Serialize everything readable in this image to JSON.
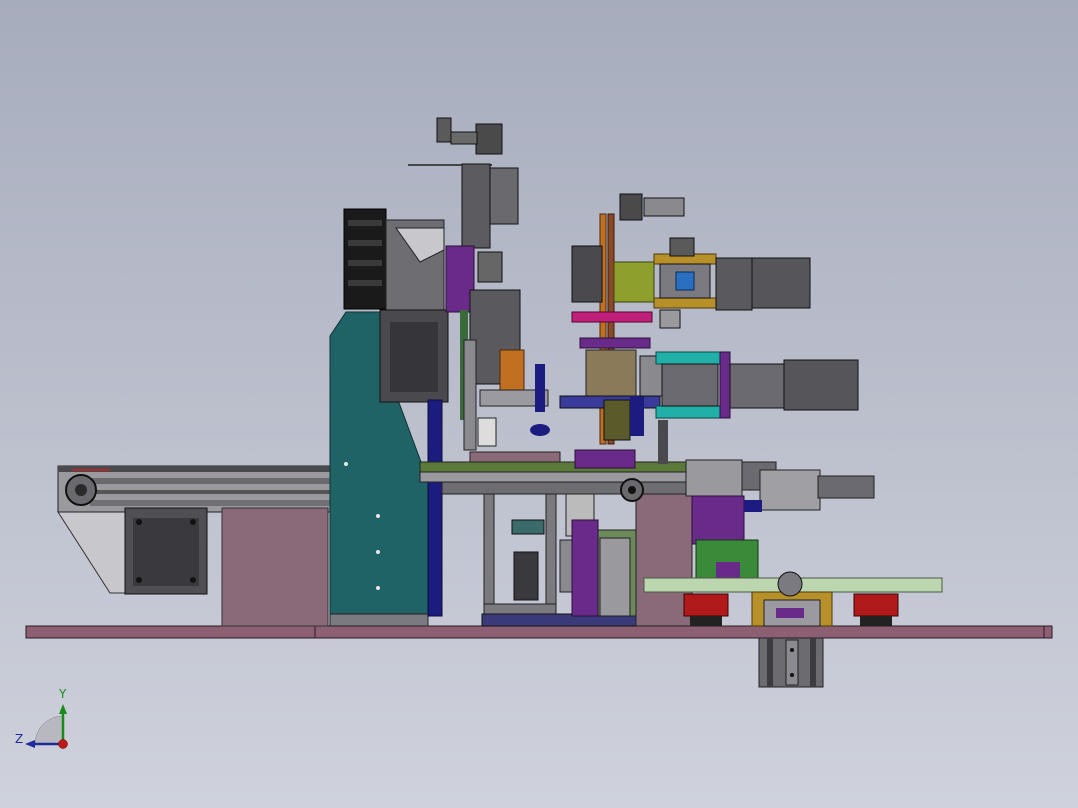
{
  "view": {
    "background_top": "#a7acbd",
    "background_bottom": "#cfd2dc"
  },
  "triad": {
    "y_label": "Y",
    "z_label": "Z",
    "y_color": "#1a8a1a",
    "z_color": "#1d2c9a",
    "x_color": "#c01818"
  },
  "palette": {
    "base_plate": "#8c5f73",
    "teal_frame": "#1f6366",
    "dark_metal": "#3a3a3a",
    "grey_motor": "#5a5a5a",
    "olive": "#8e9f2e",
    "purple": "#6a2a8a",
    "orange": "#c07020",
    "cyan": "#20b0a8",
    "red_block": "#b01a1a",
    "light_green": "#bcd6b0",
    "navy": "#1c1c80",
    "magenta": "#c0207a"
  }
}
